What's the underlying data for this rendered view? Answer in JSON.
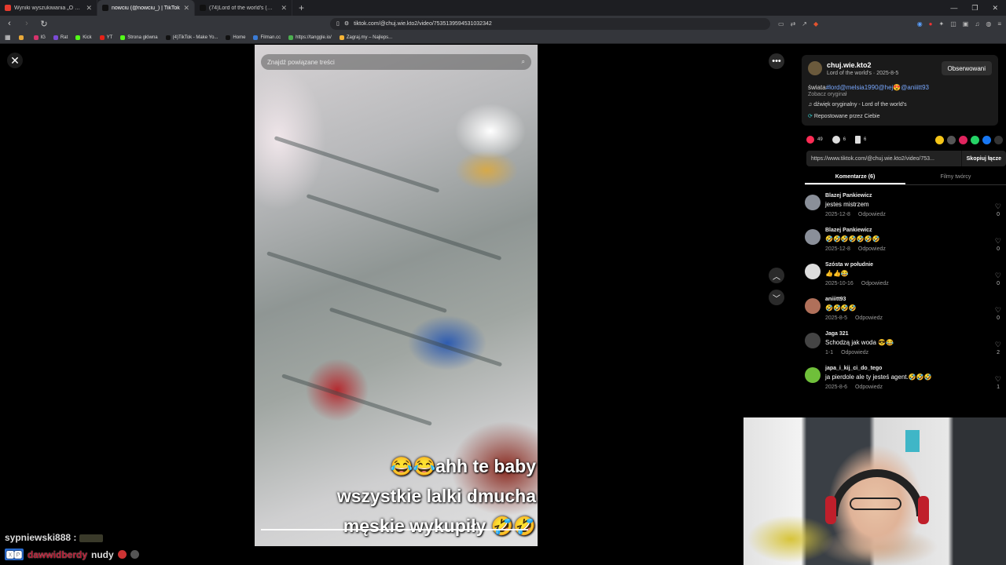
{
  "tabs": [
    {
      "title": "Wyniki wyszukiwania „O PANI\" w ser",
      "color": "#e63b2e",
      "active": false
    },
    {
      "title": "nowciu (@nowciu_) | TikTok",
      "color": "#111111",
      "active": true
    },
    {
      "title": "(74)Lord of the world's (@chuj.wie.kt",
      "color": "#111111",
      "active": false
    }
  ],
  "window_controls": [
    "—",
    "❐",
    "✕"
  ],
  "url": "tiktok.com/@chuj.wie.kto2/video/7535139594531032342",
  "bookmarks": [
    {
      "label": "",
      "color": "#e8a93a"
    },
    {
      "label": "IG",
      "color": "#d6336c"
    },
    {
      "label": "Rat",
      "color": "#7a4bd6"
    },
    {
      "label": "Kick",
      "color": "#53fc18"
    },
    {
      "label": "YT",
      "color": "#e62117"
    },
    {
      "label": "Strona główna",
      "color": "#53fc18"
    },
    {
      "label": "(4)TikTok - Make Yo...",
      "color": "#111111"
    },
    {
      "label": "Home",
      "color": "#111111"
    },
    {
      "label": "Filman.cc",
      "color": "#3a7bd5"
    },
    {
      "label": "https://tanggle.io/",
      "color": "#4caf50"
    },
    {
      "label": "Zagraj.my – Najleps...",
      "color": "#f5b335"
    }
  ],
  "video": {
    "search_placeholder": "Znajdź powiązane treści",
    "caption_line1": "😂😂ahh te baby",
    "caption_line2": "wszystkie lalki dmucha",
    "caption_line3": "męskie wykupiły 🤣🤣"
  },
  "author": {
    "name": "chuj.wie.kto2",
    "subtitle": "Lord of the world's · 2025-8-5",
    "follow_label": "Obserwowani",
    "desc_prefix": "świata",
    "desc_tags": "#lord@melsia1990@hej😍@aniiitt93",
    "see_original": "Zobacz oryginał",
    "sound": "♫  dźwięk oryginalny - Lord of the world's",
    "repost": "Repostowane przez Ciebie"
  },
  "stats": {
    "likes": "49",
    "comments": "6",
    "saves": "6"
  },
  "share_colors": [
    "#f5c518",
    "#555555",
    "#e0245e",
    "#25d366",
    "#1877f2",
    "#333333"
  ],
  "link": {
    "url": "https://www.tiktok.com/@chuj.wie.kto2/video/753...",
    "copy_label": "Skopiuj łącze"
  },
  "panel_tabs": {
    "comments": "Komentarze (6)",
    "creator": "Filmy twórcy"
  },
  "comments": [
    {
      "user": "Blazej Pankiewicz",
      "text": "jestes mistrzem",
      "date": "2025-12-8",
      "reply": "Odpowiedz",
      "likes": "0",
      "avatar": "#8a8f99"
    },
    {
      "user": "Blazej Pankiewicz",
      "text": "🤣🤣🤣🤣🤣🤣🤣",
      "date": "2025-12-8",
      "reply": "Odpowiedz",
      "likes": "0",
      "avatar": "#8a8f99"
    },
    {
      "user": "Szósta w południe",
      "text": "👍👍😂",
      "date": "2025-10-16",
      "reply": "Odpowiedz",
      "likes": "0",
      "avatar": "#dddddd"
    },
    {
      "user": "aniiitt93",
      "text": "🤣🤣🤣🤣",
      "date": "2025-8-5",
      "reply": "Odpowiedz",
      "likes": "0",
      "avatar": "#b0705a"
    },
    {
      "user": "Jaga 321",
      "text": "Schodzą jak woda 😎😂",
      "date": "1-1",
      "reply": "Odpowiedz",
      "likes": "2",
      "avatar": "#444444"
    },
    {
      "user": "japa_i_kij_ci_do_tego",
      "text": "ja pierdole ale ty jesteś agent.🤣🤣🤣",
      "date": "2025-8-6",
      "reply": "Odpowiedz",
      "likes": "1",
      "avatar": "#6fbf3a"
    }
  ],
  "chat": {
    "line1_user": "sypniewski888 :",
    "line2_badge": "🆇🅿",
    "line2_user": "dawwidberdy",
    "line2_text": "nudy"
  }
}
